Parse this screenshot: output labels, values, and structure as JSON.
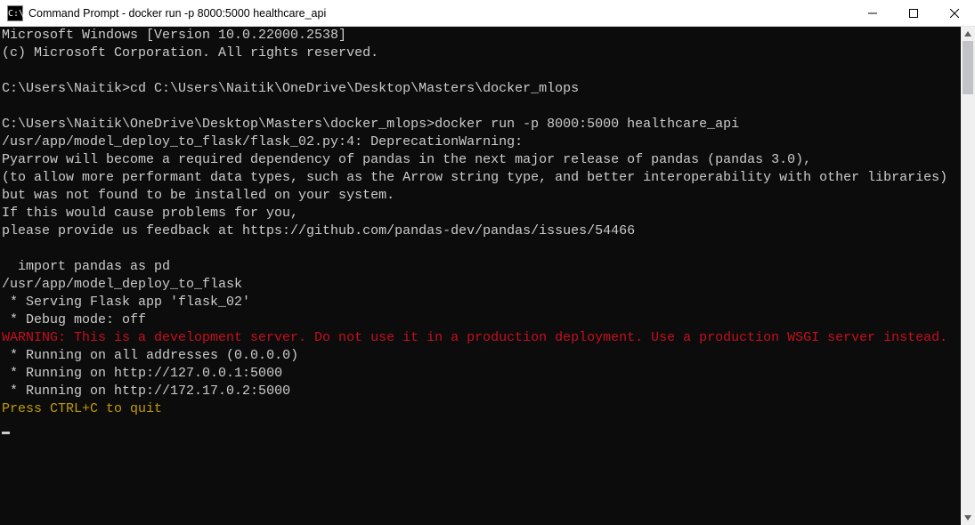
{
  "window": {
    "title": "Command Prompt - docker  run -p 8000:5000 healthcare_api",
    "icon_label": "C:\\"
  },
  "terminal": {
    "lines": [
      {
        "text": "Microsoft Windows [Version 10.0.22000.2538]"
      },
      {
        "text": "(c) Microsoft Corporation. All rights reserved."
      },
      {
        "text": ""
      },
      {
        "text": "C:\\Users\\Naitik>cd C:\\Users\\Naitik\\OneDrive\\Desktop\\Masters\\docker_mlops"
      },
      {
        "text": ""
      },
      {
        "text": "C:\\Users\\Naitik\\OneDrive\\Desktop\\Masters\\docker_mlops>docker run -p 8000:5000 healthcare_api"
      },
      {
        "text": "/usr/app/model_deploy_to_flask/flask_02.py:4: DeprecationWarning:"
      },
      {
        "text": "Pyarrow will become a required dependency of pandas in the next major release of pandas (pandas 3.0),"
      },
      {
        "text": "(to allow more performant data types, such as the Arrow string type, and better interoperability with other libraries)"
      },
      {
        "text": "but was not found to be installed on your system."
      },
      {
        "text": "If this would cause problems for you,"
      },
      {
        "text": "please provide us feedback at https://github.com/pandas-dev/pandas/issues/54466"
      },
      {
        "text": ""
      },
      {
        "text": "  import pandas as pd"
      },
      {
        "text": "/usr/app/model_deploy_to_flask"
      },
      {
        "text": " * Serving Flask app 'flask_02'"
      },
      {
        "text": " * Debug mode: off"
      },
      {
        "text": "WARNING: This is a development server. Do not use it in a production deployment. Use a production WSGI server instead.",
        "cls": "red"
      },
      {
        "text": " * Running on all addresses (0.0.0.0)"
      },
      {
        "text": " * Running on http://127.0.0.1:5000"
      },
      {
        "text": " * Running on http://172.17.0.2:5000"
      },
      {
        "text": "Press CTRL+C to quit",
        "cls": "yellow"
      }
    ]
  }
}
